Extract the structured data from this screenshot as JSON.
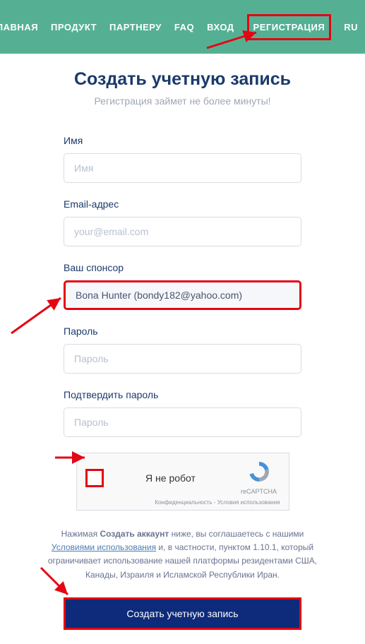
{
  "nav": {
    "items": [
      "ГЛАВНАЯ",
      "ПРОДУКТ",
      "ПАРТНЕРУ",
      "FAQ",
      "ВХОД",
      "РЕГИСТРАЦИЯ",
      "RU"
    ]
  },
  "title": "Создать учетную запись",
  "subtitle": "Регистрация займет не более минуты!",
  "fields": {
    "name": {
      "label": "Имя",
      "placeholder": "Имя"
    },
    "email": {
      "label": "Email-адрес",
      "placeholder": "your@email.com"
    },
    "sponsor": {
      "label": "Ваш спонсор",
      "value": "Bona Hunter (bondy182@yahoo.com)"
    },
    "password": {
      "label": "Пароль",
      "placeholder": "Пароль"
    },
    "confirm": {
      "label": "Подтвердить пароль",
      "placeholder": "Пароль"
    }
  },
  "captcha": {
    "label": "Я не робот",
    "brand": "reCAPTCHA",
    "footer": "Конфиденциальность - Условия использования"
  },
  "terms": {
    "prefix": "Нажимая ",
    "bold": "Создать аккаунт",
    "mid1": " ниже, вы соглашаетесь с нашими ",
    "link": "Условиями использования",
    "mid2": " и, в частности, пунктом 1.10.1, который ограничивает использование нашей платформы резидентами США, Канады, Израиля и Исламской Республики Иран."
  },
  "submit": "Создать учетную запись",
  "colors": {
    "accent": "#e30613",
    "navbar": "#55b093",
    "primary": "#0d2b7a"
  }
}
